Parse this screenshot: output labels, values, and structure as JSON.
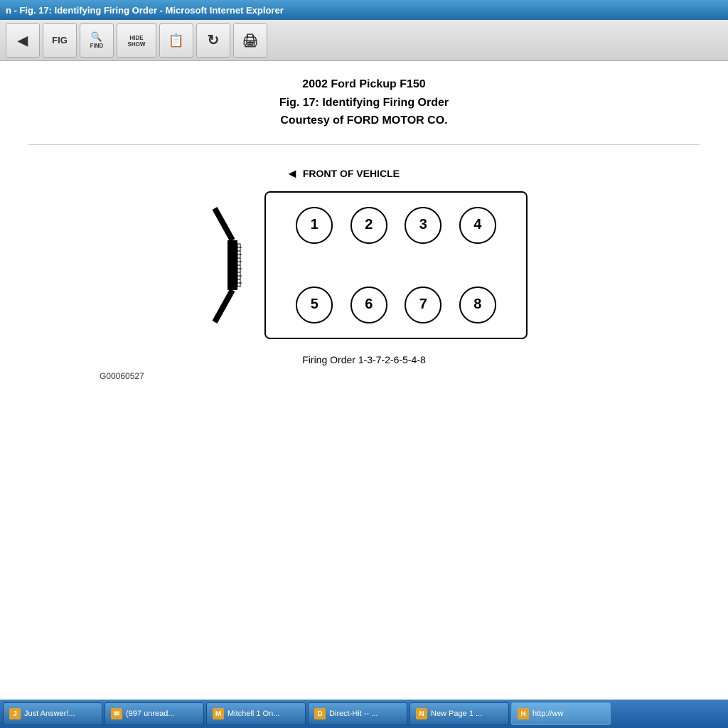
{
  "titleBar": {
    "text": "n - Fig. 17: Identifying Firing Order - Microsoft Internet Explorer"
  },
  "toolbar": {
    "buttons": [
      {
        "id": "btn-prev",
        "label": "",
        "icon": "◀",
        "tooltip": "Previous"
      },
      {
        "id": "btn-fig",
        "label": "FIG",
        "icon": "📄",
        "tooltip": "Fig"
      },
      {
        "id": "btn-find",
        "label": "FIND",
        "icon": "🔍",
        "tooltip": "Find"
      },
      {
        "id": "btn-hideshow",
        "label": "HIDE SHOW",
        "icon": "",
        "tooltip": "Hide/Show"
      },
      {
        "id": "btn-nav",
        "label": "",
        "icon": "📋",
        "tooltip": "Navigate"
      },
      {
        "id": "btn-refresh",
        "label": "",
        "icon": "↻",
        "tooltip": "Refresh"
      },
      {
        "id": "btn-print",
        "label": "",
        "icon": "🖨",
        "tooltip": "Print"
      }
    ]
  },
  "pageTitle": {
    "line1": "2002 Ford Pickup F150",
    "line2": "Fig. 17: Identifying Firing Order",
    "line3": "Courtesy of FORD MOTOR CO."
  },
  "diagram": {
    "frontLabel": "FRONT OF VEHICLE",
    "cylinders": {
      "topRow": [
        "①",
        "②",
        "③",
        "④"
      ],
      "bottomRow": [
        "⑤",
        "⑥",
        "⑦",
        "⑧"
      ]
    },
    "firingOrder": "Firing Order 1-3-7-2-6-5-4-8",
    "partNumber": "G00060527"
  },
  "taskbar": {
    "items": [
      {
        "id": "task-justanswer",
        "label": "Just Answer!...",
        "active": false
      },
      {
        "id": "task-997unread",
        "label": "(997 unread...",
        "active": false
      },
      {
        "id": "task-mitchell",
        "label": "Mitchell 1 On...",
        "active": false
      },
      {
        "id": "task-directhit",
        "label": "Direct-Hit -- ...",
        "active": false
      },
      {
        "id": "task-newpage1",
        "label": "New Page 1 ...",
        "active": false
      },
      {
        "id": "task-http",
        "label": "http://ww",
        "active": true
      }
    ]
  }
}
